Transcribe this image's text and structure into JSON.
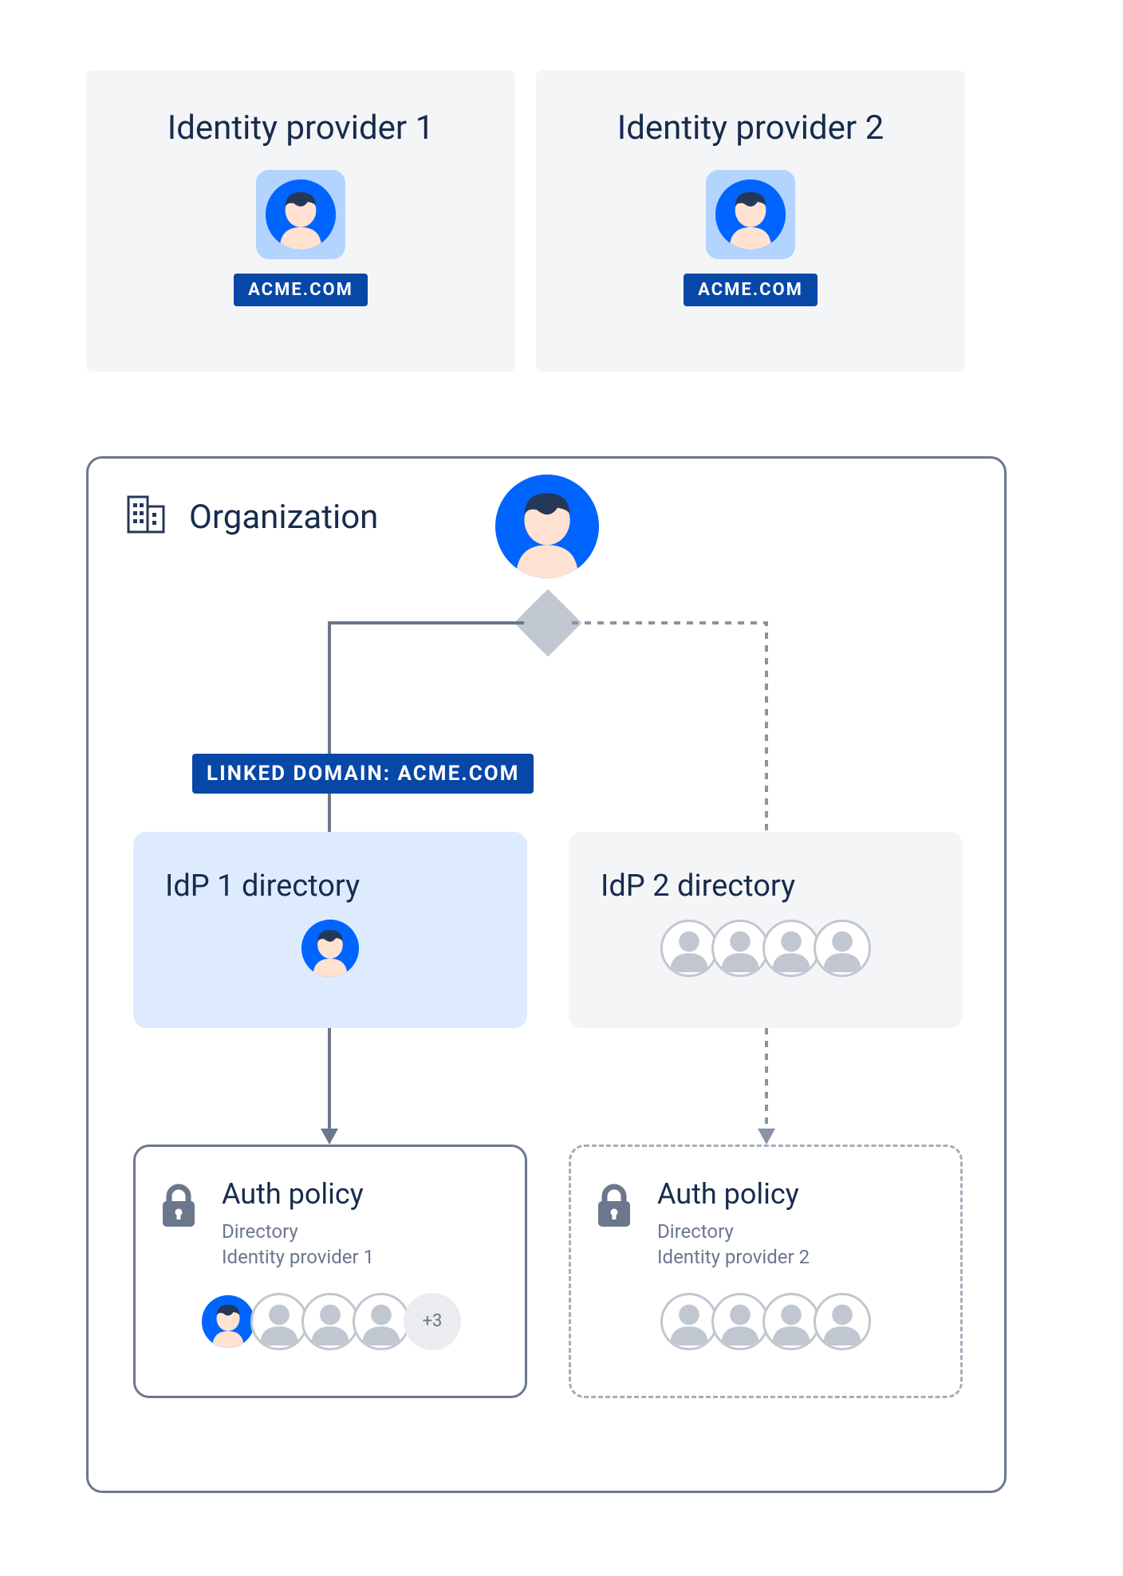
{
  "idp1": {
    "title": "Identity provider 1",
    "domain": "ACME.COM"
  },
  "idp2": {
    "title": "Identity provider 2",
    "domain": "ACME.COM"
  },
  "organization": {
    "label": "Organization"
  },
  "linked_domain_label": "LINKED DOMAIN: ACME.COM",
  "dir1": {
    "title": "IdP 1 directory"
  },
  "dir2": {
    "title": "IdP 2 directory"
  },
  "policy1": {
    "title": "Auth policy",
    "subtitle_line1": "Directory",
    "subtitle_line2": "Identity provider 1",
    "extra_count": "+3"
  },
  "policy2": {
    "title": "Auth policy",
    "subtitle_line1": "Directory",
    "subtitle_line2": "Identity provider 2"
  },
  "colors": {
    "primary_blue": "#0065ff",
    "badge_blue": "#0747a6",
    "light_blue": "#deebff",
    "panel_gray": "#f4f5f7",
    "border_gray": "#6b778c",
    "avatar_hair": "#253858",
    "avatar_face": "#ffe2d1"
  }
}
